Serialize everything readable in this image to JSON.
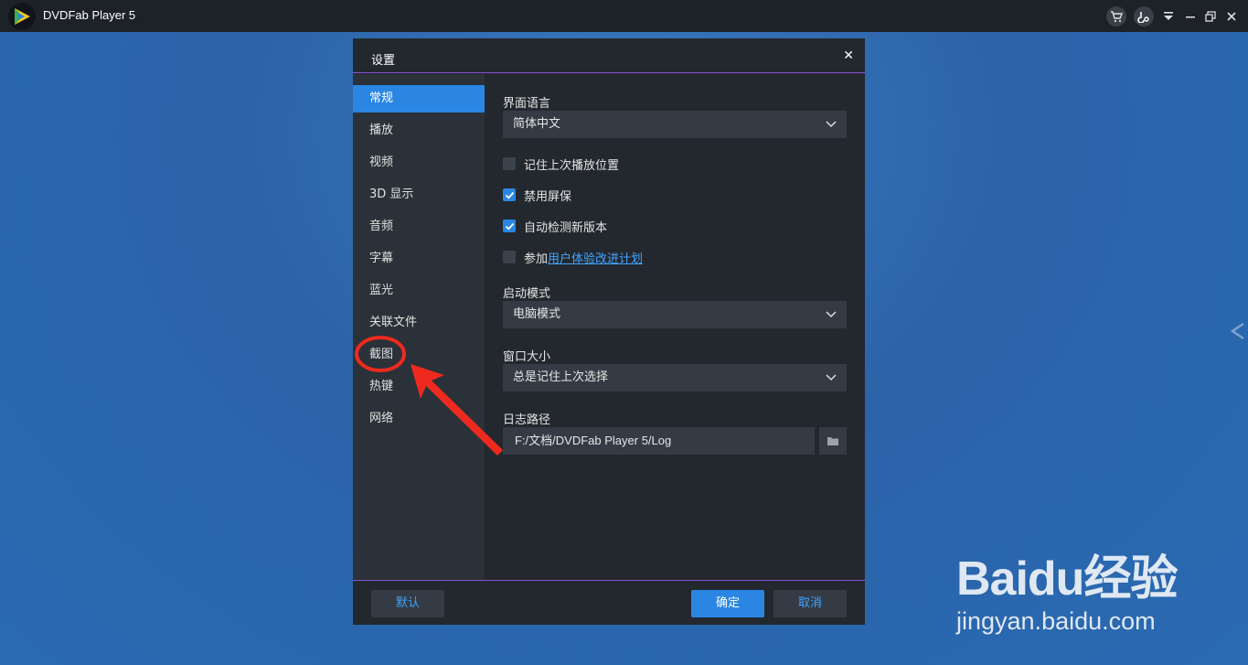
{
  "window": {
    "title": "DVDFab Player 5"
  },
  "dialog": {
    "title": "设置",
    "close_symbol": "✕"
  },
  "sidebar": {
    "items": [
      {
        "label": "常规",
        "active": true
      },
      {
        "label": "播放"
      },
      {
        "label": "视频"
      },
      {
        "label": "3D 显示"
      },
      {
        "label": "音频"
      },
      {
        "label": "字幕"
      },
      {
        "label": "蓝光"
      },
      {
        "label": "关联文件"
      },
      {
        "label": "截图"
      },
      {
        "label": "热键"
      },
      {
        "label": "网络"
      }
    ]
  },
  "general": {
    "language_label": "界面语言",
    "language_value": "简体中文",
    "remember_position": {
      "label": "记住上次播放位置",
      "checked": false
    },
    "disable_screensaver": {
      "label": "禁用屏保",
      "checked": true
    },
    "auto_check_update": {
      "label": "自动检测新版本",
      "checked": true
    },
    "join_program": {
      "prefix": "参加",
      "link": "用户体验改进计划",
      "checked": false
    },
    "startup_mode_label": "启动模式",
    "startup_mode_value": "电脑模式",
    "window_size_label": "窗口大小",
    "window_size_value": "总是记住上次选择",
    "log_path_label": "日志路径",
    "log_path_value": "F:/文档/DVDFab Player 5/Log"
  },
  "footer": {
    "default_label": "默认",
    "ok_label": "确定",
    "cancel_label": "取消"
  },
  "watermark": {
    "logo_text": "Baidu经验",
    "url": "jingyan.baidu.com"
  },
  "colors": {
    "accent": "#2a86e2",
    "annotation": "#ee2a1f",
    "divider": "#8a4fd6"
  }
}
